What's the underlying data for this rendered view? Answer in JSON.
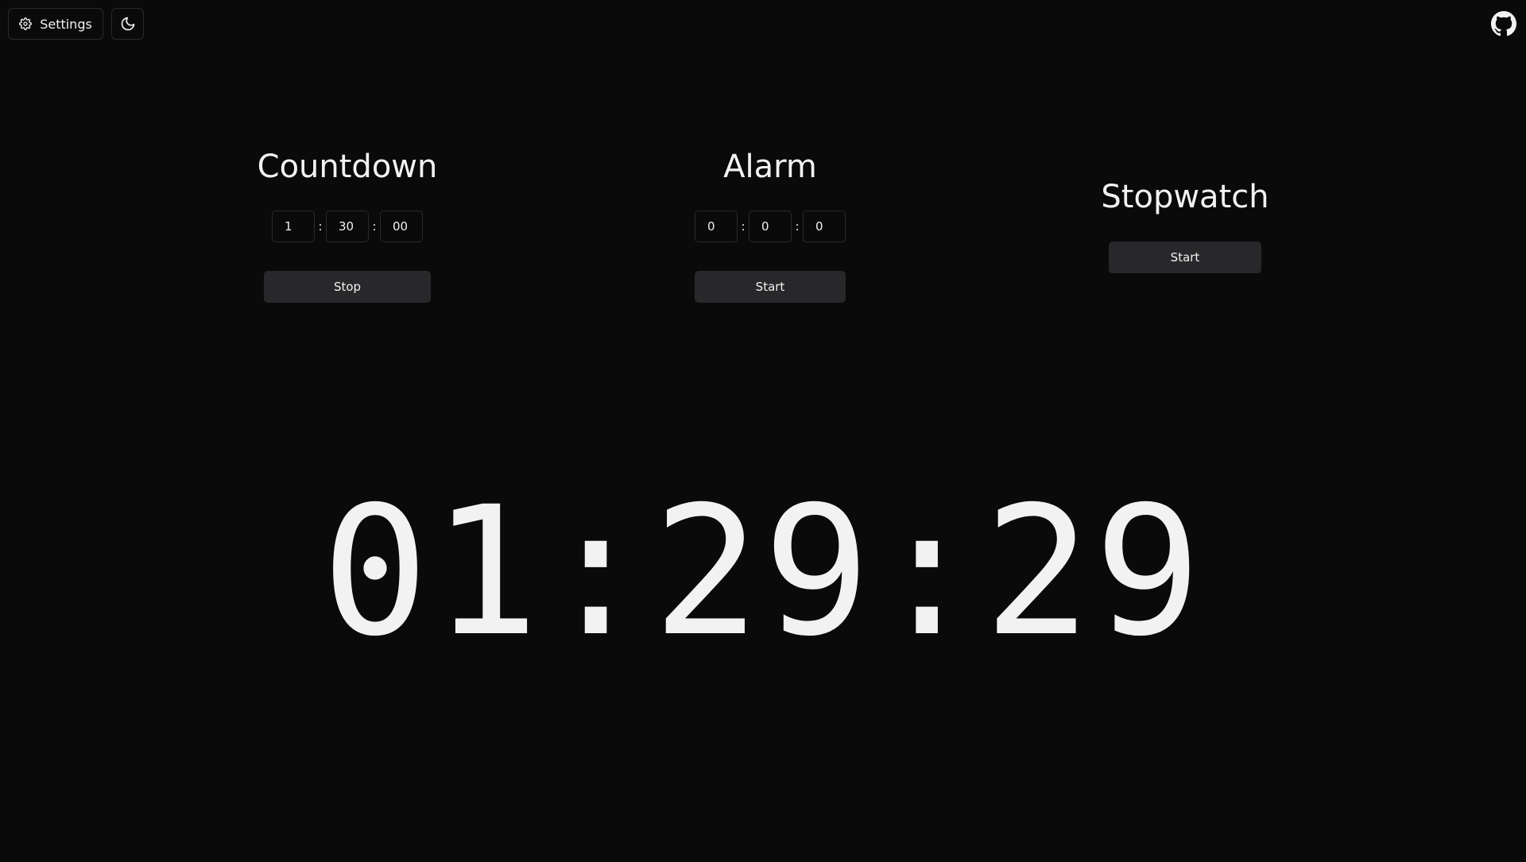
{
  "header": {
    "settings_label": "Settings",
    "settings_icon": "gear-icon",
    "theme_icon": "moon-icon",
    "github_icon": "github-icon"
  },
  "countdown": {
    "title": "Countdown",
    "hours": "1",
    "minutes": "30",
    "seconds": "00",
    "button_label": "Stop"
  },
  "alarm": {
    "title": "Alarm",
    "hours": "0",
    "minutes": "0",
    "seconds": "0",
    "button_label": "Start"
  },
  "stopwatch": {
    "title": "Stopwatch",
    "button_label": "Start"
  },
  "display": {
    "time": "01:29:29"
  },
  "colors": {
    "background": "#0b0a0a",
    "text": "#f2f2f2",
    "button_bg": "#28282b",
    "border": "#2a2a2c"
  }
}
